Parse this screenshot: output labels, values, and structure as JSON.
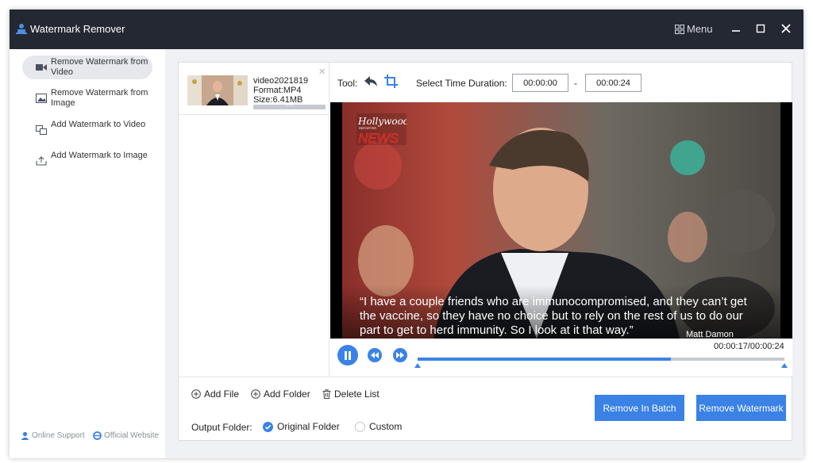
{
  "app": {
    "title": "Watermark Remover"
  },
  "titlebar": {
    "menu_label": "Menu"
  },
  "sidebar": {
    "items": [
      {
        "label": "Remove Watermark from Video",
        "icon": "video-icon",
        "active": true
      },
      {
        "label": "Remove Watermark from Image",
        "icon": "image-icon",
        "active": false
      },
      {
        "label": "Add Watermark to Video",
        "icon": "add-video-icon",
        "active": false
      },
      {
        "label": "Add Watermark to Image",
        "icon": "upload-image-icon",
        "active": false
      }
    ],
    "online_support": "Online Support",
    "official_website": "Official Website"
  },
  "file": {
    "name": "video2021819",
    "format": "Format:MP4",
    "size": "Size:6.41MB",
    "progress_text": "0%"
  },
  "toolbar": {
    "tool_label": "Tool:",
    "duration_label": "Select Time Duration:",
    "start_time": "00:00:00",
    "dash": "-",
    "end_time": "00:00:24"
  },
  "video": {
    "badge_top": "Hollywood",
    "badge_sub": "REPORTER",
    "badge_news": "NEWS",
    "quote": "“I have a couple friends who are immunocompromised, and they can’t get the vaccine, so they have no choice but to rely on the rest of us to do our part to get to herd immunity. So I look at it that way.”",
    "speaker": "Matt Damon"
  },
  "player": {
    "time": "00:00:17/00:00:24",
    "progress": 0.69
  },
  "actions": {
    "add_file": "Add File",
    "add_folder": "Add Folder",
    "delete_list": "Delete List",
    "output_label": "Output Folder:",
    "original_folder": "Original Folder",
    "custom": "Custom",
    "remove_batch": "Remove In Batch",
    "remove_watermark": "Remove Watermark"
  },
  "colors": {
    "accent": "#3b82e6",
    "titlebar": "#232833",
    "news_red": "#d8322b"
  }
}
